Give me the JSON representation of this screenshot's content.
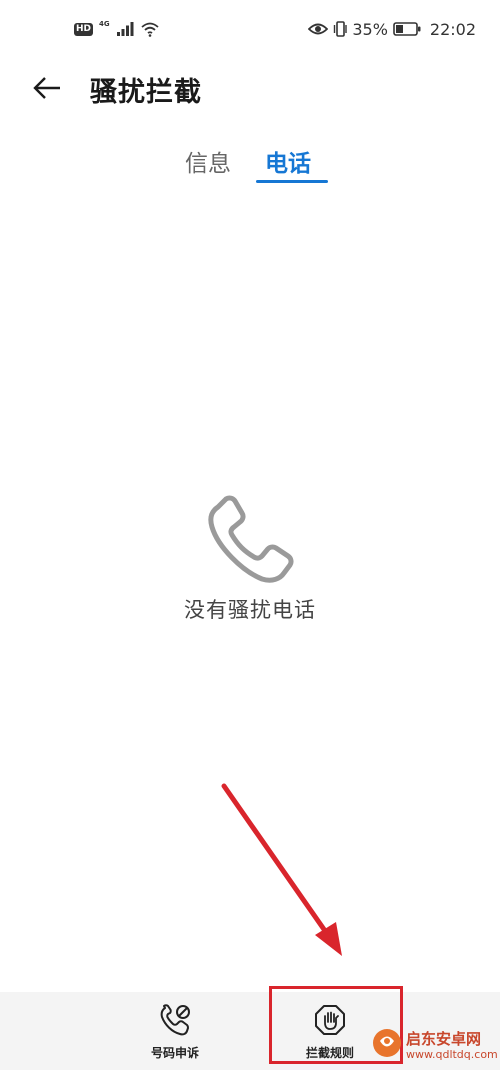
{
  "status_bar": {
    "hd_badge": "HD",
    "network": "4G",
    "battery_percent": "35%",
    "time": "22:02",
    "icons": [
      "signal-icon",
      "wifi-icon",
      "eye-comfort-icon",
      "vibrate-icon",
      "battery-icon"
    ]
  },
  "header": {
    "title": "骚扰拦截",
    "back_icon": "arrow-left-icon"
  },
  "tabs": [
    {
      "label": "信息",
      "active": false
    },
    {
      "label": "电话",
      "active": true
    }
  ],
  "empty_state": {
    "icon": "phone-icon",
    "message": "没有骚扰电话"
  },
  "bottom_bar": {
    "appeal_label": "号码申诉",
    "appeal_icon": "phone-blocked-icon",
    "rules_label": "拦截规则",
    "rules_icon": "hand-stop-icon"
  },
  "watermark": {
    "text": "启东安卓网",
    "url": "www.qdltdq.com"
  },
  "colors": {
    "accent": "#1677d4",
    "annotation": "#d9252c"
  }
}
